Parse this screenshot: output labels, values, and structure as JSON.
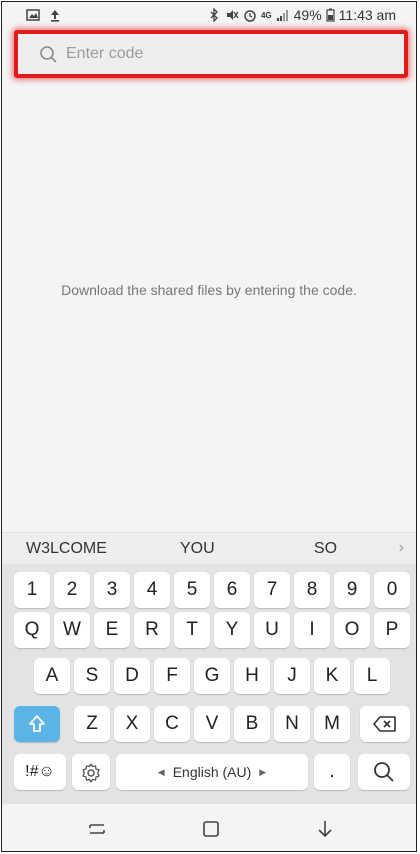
{
  "status_bar": {
    "battery": "49%",
    "time": "11:43 am",
    "network": "4G"
  },
  "search": {
    "placeholder": "Enter code"
  },
  "message": "Download the shared files by entering the code.",
  "suggestions": [
    "W3LCOME",
    "YOU",
    "SO"
  ],
  "keyboard": {
    "row1": [
      "1",
      "2",
      "3",
      "4",
      "5",
      "6",
      "7",
      "8",
      "9",
      "0"
    ],
    "row2": [
      "Q",
      "W",
      "E",
      "R",
      "T",
      "Y",
      "U",
      "I",
      "O",
      "P"
    ],
    "row3": [
      "A",
      "S",
      "D",
      "F",
      "G",
      "H",
      "J",
      "K",
      "L"
    ],
    "row4": [
      "Z",
      "X",
      "C",
      "V",
      "B",
      "N",
      "M"
    ],
    "symbols": "!#☺",
    "space": "English (AU)",
    "period": "."
  },
  "colors": {
    "highlight": "#e01b1b",
    "shift": "#5ab4e6"
  }
}
